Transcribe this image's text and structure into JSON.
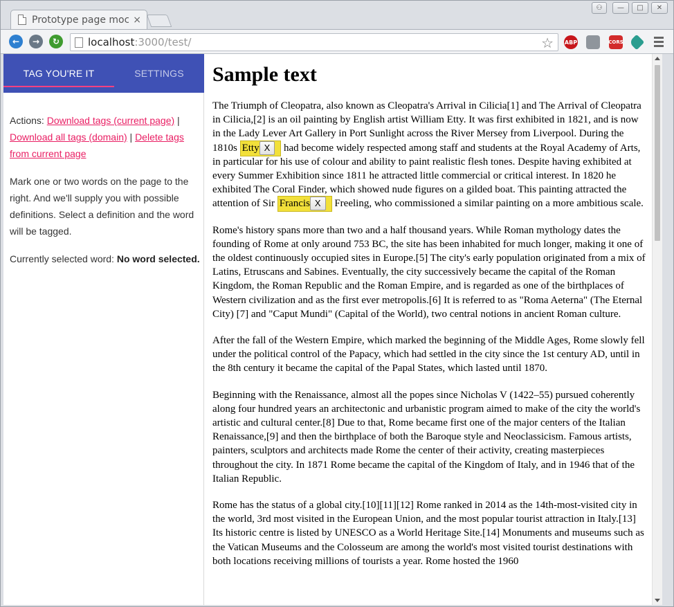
{
  "browser": {
    "tab_title": "Prototype page mock",
    "tab_close": "×",
    "url_host": "localhost",
    "url_rest": ":3000/test/",
    "bookmark_icon": "star-icon",
    "extensions": {
      "abp": "ABP",
      "cors": "CORS"
    }
  },
  "sidebar": {
    "tabs": [
      {
        "label": "TAG YOU'RE IT",
        "active": true
      },
      {
        "label": "SETTINGS",
        "active": false
      }
    ],
    "actions_prefix": "Actions: ",
    "download_current": "Download tags (current page)",
    "separator": " | ",
    "download_all": "Download all tags (domain)",
    "delete_current": "Delete tags from current page",
    "instructions": "Mark one or two words on the page to the right. And we'll supply you with possible definitions. Select a definition and the word will be tagged.",
    "selected_prefix": "Currently selected word: ",
    "selected_value": "No word selected."
  },
  "content": {
    "title": "Sample text",
    "p1_a": "The Triumph of Cleopatra, also known as Cleopatra's Arrival in Cilicia[1] and The Arrival of Cleopatra in Cilicia,[2] is an oil painting by English artist William Etty. It was first exhibited in 1821, and is now in the Lady Lever Art Gallery in Port Sunlight across the River Mersey from Liverpool. During the 1810s ",
    "tag1_word": "Etty",
    "tag_remove": "X",
    "p1_b": " had become widely respected among staff and students at the Royal Academy of Arts, in particular for his use of colour and ability to paint realistic flesh tones. Despite having exhibited at every Summer Exhibition since 1811 he attracted little commercial or critical interest. In 1820 he exhibited The Coral Finder, which showed nude figures on a gilded boat. This painting attracted the attention of Sir ",
    "tag2_word": "Francis",
    "p1_c": " Freeling, who commissioned a similar painting on a more ambitious scale.",
    "p2": "Rome's history spans more than two and a half thousand years. While Roman mythology dates the founding of Rome at only around 753 BC, the site has been inhabited for much longer, making it one of the oldest continuously occupied sites in Europe.[5] The city's early population originated from a mix of Latins, Etruscans and Sabines. Eventually, the city successively became the capital of the Roman Kingdom, the Roman Republic and the Roman Empire, and is regarded as one of the birthplaces of Western civilization and as the first ever metropolis.[6] It is referred to as \"Roma Aeterna\" (The Eternal City) [7] and \"Caput Mundi\" (Capital of the World), two central notions in ancient Roman culture.",
    "p3": "After the fall of the Western Empire, which marked the beginning of the Middle Ages, Rome slowly fell under the political control of the Papacy, which had settled in the city since the 1st century AD, until in the 8th century it became the capital of the Papal States, which lasted until 1870.",
    "p4": "Beginning with the Renaissance, almost all the popes since Nicholas V (1422–55) pursued coherently along four hundred years an architectonic and urbanistic program aimed to make of the city the world's artistic and cultural center.[8] Due to that, Rome became first one of the major centers of the Italian Renaissance,[9] and then the birthplace of both the Baroque style and Neoclassicism. Famous artists, painters, sculptors and architects made Rome the center of their activity, creating masterpieces throughout the city. In 1871 Rome became the capital of the Kingdom of Italy, and in 1946 that of the Italian Republic.",
    "p5": "Rome has the status of a global city.[10][11][12] Rome ranked in 2014 as the 14th-most-visited city in the world, 3rd most visited in the European Union, and the most popular tourist attraction in Italy.[13] Its historic centre is listed by UNESCO as a World Heritage Site.[14] Monuments and museums such as the Vatican Museums and the Colosseum are among the world's most visited tourist destinations with both locations receiving millions of tourists a year. Rome hosted the 1960"
  },
  "colors": {
    "sidebar_header": "#3f51b5",
    "accent": "#ff4081",
    "link": "#e91e63",
    "tag_highlight": "#f2e03a"
  }
}
